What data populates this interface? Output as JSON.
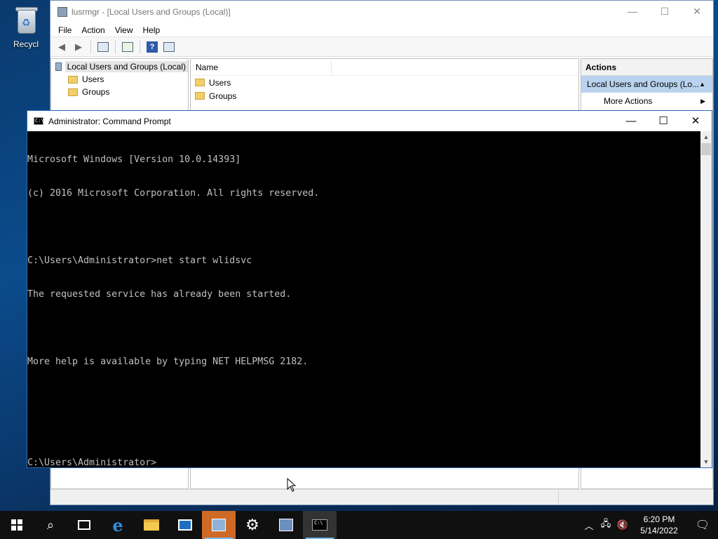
{
  "desktop": {
    "recycle_bin_label": "Recycl"
  },
  "mmc": {
    "title": "lusrmgr - [Local Users and Groups (Local)]",
    "menu": [
      "File",
      "Action",
      "View",
      "Help"
    ],
    "tree": {
      "root": "Local Users and Groups (Local)",
      "children": [
        "Users",
        "Groups"
      ]
    },
    "list": {
      "column_name": "Name",
      "rows": [
        "Users",
        "Groups"
      ]
    },
    "actions": {
      "header": "Actions",
      "selected": "Local Users and Groups (Lo...",
      "more": "More Actions"
    }
  },
  "cmd": {
    "title": "Administrator: Command Prompt",
    "lines": [
      "Microsoft Windows [Version 10.0.14393]",
      "(c) 2016 Microsoft Corporation. All rights reserved.",
      "",
      "C:\\Users\\Administrator>net start wlidsvc",
      "The requested service has already been started.",
      "",
      "More help is available by typing NET HELPMSG 2182.",
      "",
      "",
      "C:\\Users\\Administrator>"
    ]
  },
  "taskbar": {
    "time": "6:20 PM",
    "date": "5/14/2022"
  }
}
